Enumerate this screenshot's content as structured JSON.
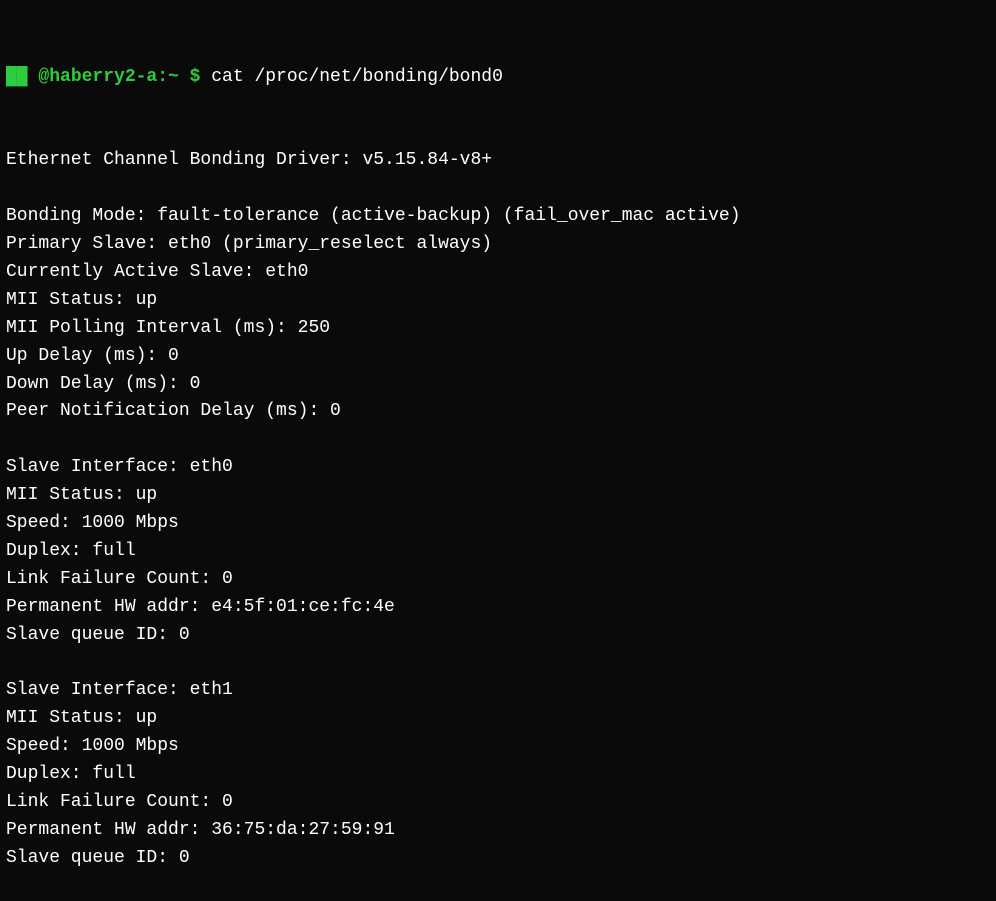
{
  "terminal": {
    "prompt": {
      "user_host": "@haberry2-a:~ $",
      "command": " cat /proc/net/bonding/bond0",
      "user_label": "user-host",
      "green_block": "██"
    },
    "output_lines": [
      "Ethernet Channel Bonding Driver: v5.15.84-v8+",
      "",
      "Bonding Mode: fault-tolerance (active-backup) (fail_over_mac active)",
      "Primary Slave: eth0 (primary_reselect always)",
      "Currently Active Slave: eth0",
      "MII Status: up",
      "MII Polling Interval (ms): 250",
      "Up Delay (ms): 0",
      "Down Delay (ms): 0",
      "Peer Notification Delay (ms): 0",
      "",
      "Slave Interface: eth0",
      "MII Status: up",
      "Speed: 1000 Mbps",
      "Duplex: full",
      "Link Failure Count: 0",
      "Permanent HW addr: e4:5f:01:ce:fc:4e",
      "Slave queue ID: 0",
      "",
      "Slave Interface: eth1",
      "MII Status: up",
      "Speed: 1000 Mbps",
      "Duplex: full",
      "Link Failure Count: 0",
      "Permanent HW addr: 36:75:da:27:59:91",
      "Slave queue ID: 0"
    ]
  }
}
